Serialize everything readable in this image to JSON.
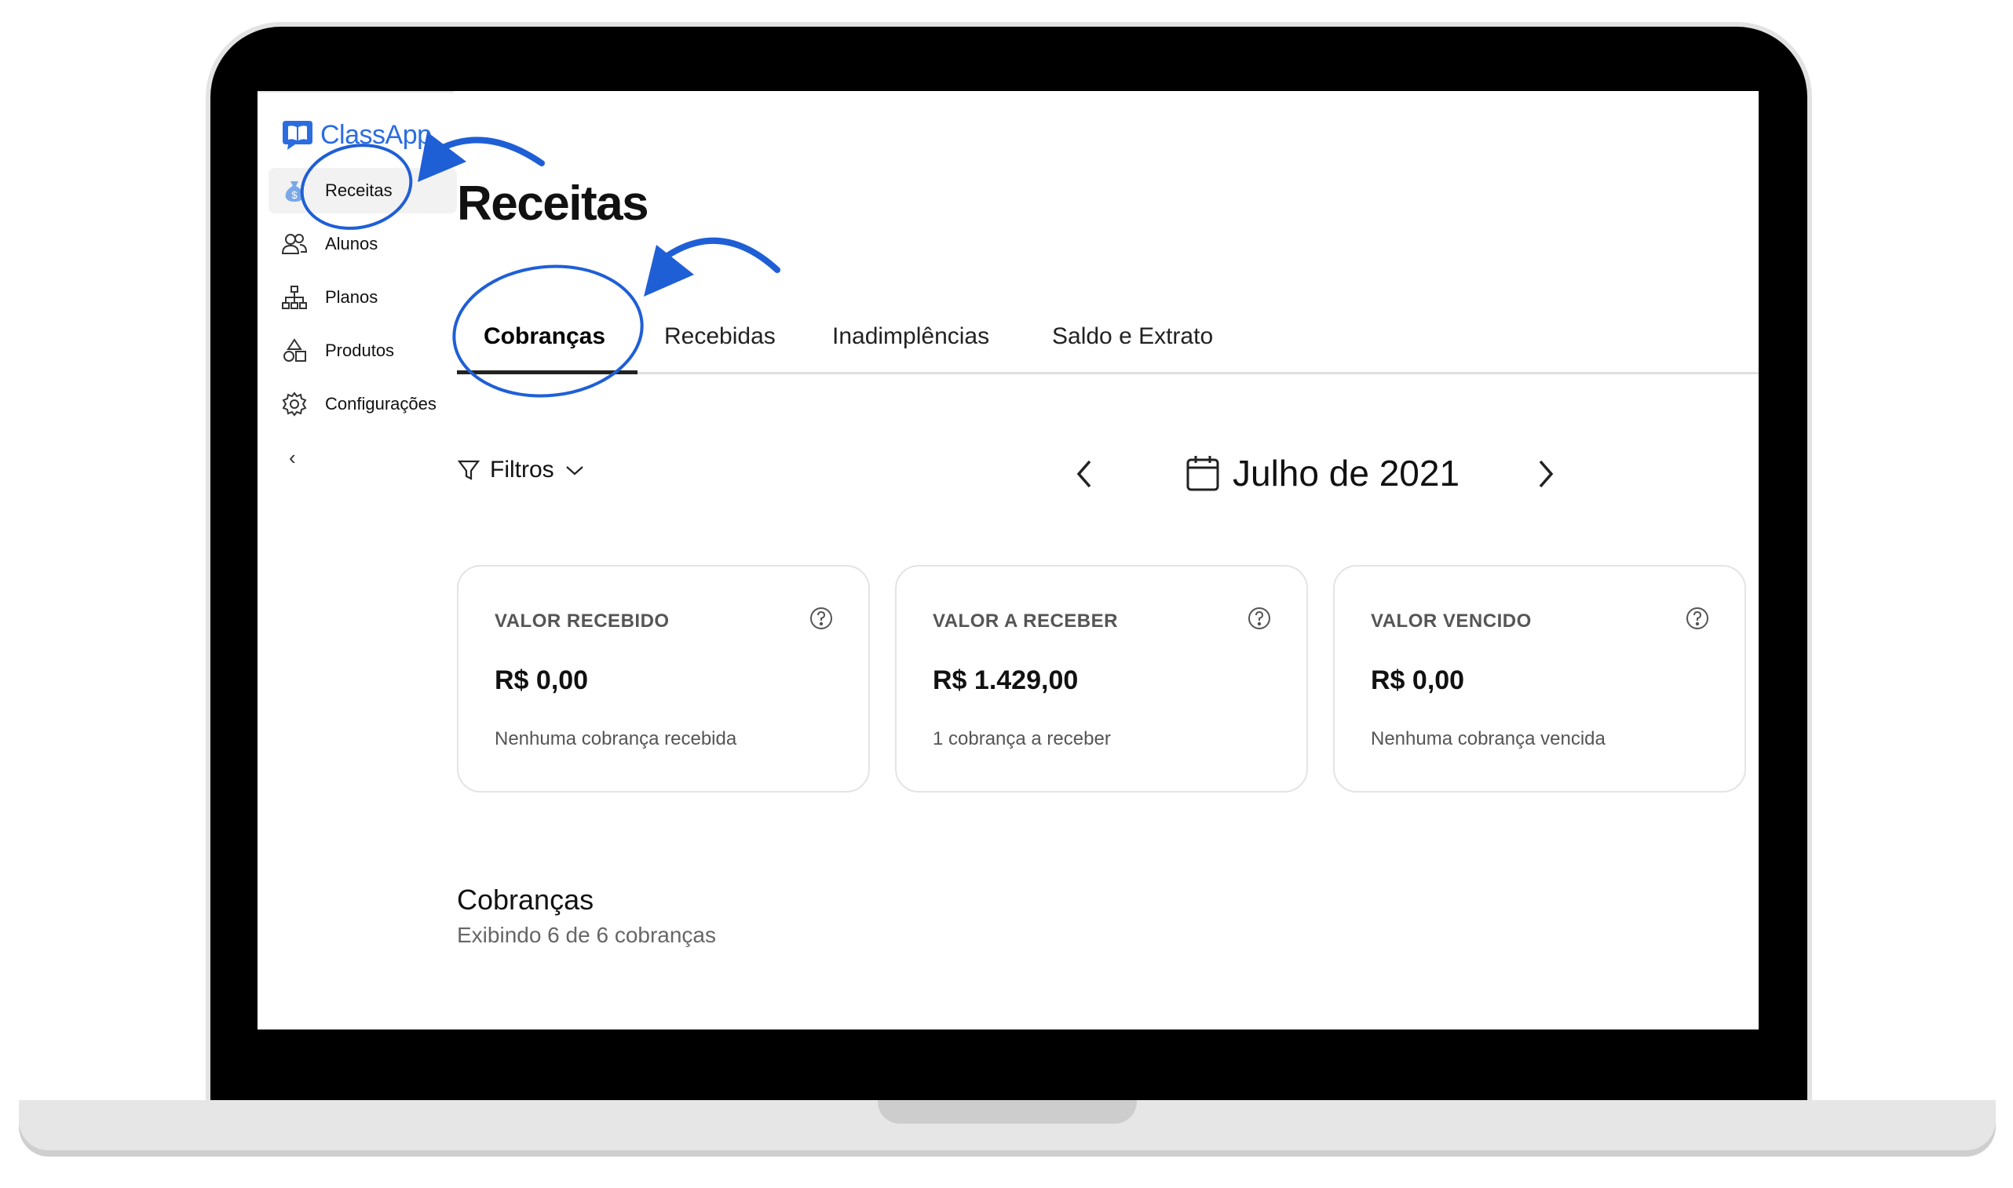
{
  "sidebar": {
    "logo_text": "ClassApp",
    "items": [
      {
        "label": "Receitas",
        "icon": "money-bag-icon"
      },
      {
        "label": "Alunos",
        "icon": "users-icon"
      },
      {
        "label": "Planos",
        "icon": "hierarchy-icon"
      },
      {
        "label": "Produtos",
        "icon": "shapes-icon"
      },
      {
        "label": "Configurações",
        "icon": "gear-icon"
      }
    ],
    "collapse_label": "‹"
  },
  "header": {
    "title": "Receitas"
  },
  "tabs": [
    {
      "label": "Cobranças",
      "active": true
    },
    {
      "label": "Recebidas"
    },
    {
      "label": "Inadimplências"
    },
    {
      "label": "Saldo e Extrato"
    }
  ],
  "toolbar": {
    "filters_label": "Filtros",
    "month_label": "Julho de 2021"
  },
  "cards": [
    {
      "label": "VALOR RECEBIDO",
      "value": "R$ 0,00",
      "note": "Nenhuma cobrança recebida"
    },
    {
      "label": "VALOR A RECEBER",
      "value": "R$ 1.429,00",
      "note": "1 cobrança a receber"
    },
    {
      "label": "VALOR VENCIDO",
      "value": "R$ 0,00",
      "note": "Nenhuma cobrança vencida"
    }
  ],
  "section": {
    "title": "Cobranças",
    "subtitle": "Exibindo 6 de 6 cobranças"
  },
  "colors": {
    "brand": "#2b6de0",
    "annotation": "#1f5fd6"
  }
}
